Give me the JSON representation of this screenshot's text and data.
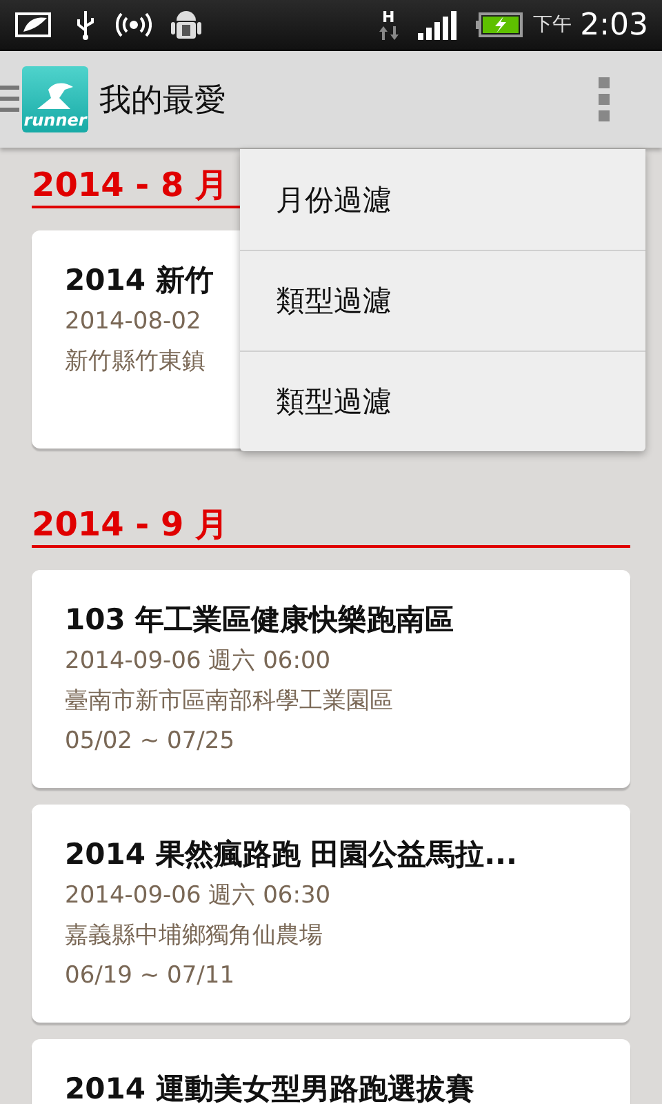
{
  "status_bar": {
    "network": "H",
    "time_period": "下午",
    "time": "2:03"
  },
  "action_bar": {
    "logo_text": "runner",
    "title": "我的最愛"
  },
  "menu": {
    "items": [
      {
        "label": "月份過濾"
      },
      {
        "label": "類型過濾"
      },
      {
        "label": "類型過濾"
      }
    ]
  },
  "sections": [
    {
      "month": "2014 - 8 月",
      "events": [
        {
          "title": "2014 新竹",
          "datetime": "2014-08-02",
          "location": "新竹縣竹東鎮"
        }
      ]
    },
    {
      "month": "2014 - 9 月",
      "events": [
        {
          "title": "103 年工業區健康快樂跑南區",
          "datetime": "2014-09-06 週六 06:00",
          "location": "臺南市新市區南部科學工業園區",
          "period": "05/02 ~ 07/25"
        },
        {
          "title": "2014 果然瘋路跑 田園公益馬拉...",
          "datetime": "2014-09-06 週六 06:30",
          "location": "嘉義縣中埔鄉獨角仙農場",
          "period": "06/19 ~ 07/11"
        },
        {
          "title": "2014 運動美女型男路跑選拔賽"
        }
      ]
    }
  ]
}
